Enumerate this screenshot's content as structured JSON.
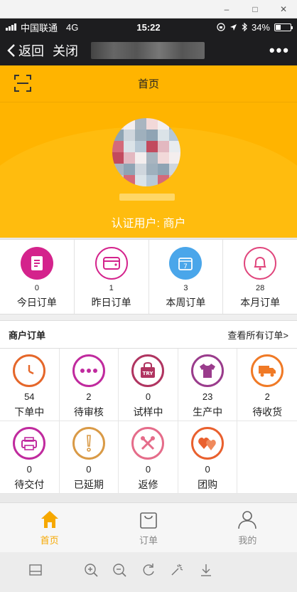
{
  "status": {
    "carrier": "中国联通",
    "network": "4G",
    "time": "15:22",
    "battery": "34%",
    "battery_level": 0.34
  },
  "nav": {
    "back": "返回",
    "close": "关闭",
    "more": "•••"
  },
  "appbar": {
    "title": "首页"
  },
  "hero": {
    "verified": "认证用户: 商户"
  },
  "stats": [
    {
      "num": "0",
      "label": "今日订单",
      "icon": "document-icon",
      "color": "#d4238c"
    },
    {
      "num": "1",
      "label": "昨日订单",
      "icon": "wallet-icon",
      "color": "#d4238c"
    },
    {
      "num": "3",
      "label": "本周订单",
      "icon": "calendar-icon",
      "color": "#4aa6ea"
    },
    {
      "num": "28",
      "label": "本月订单",
      "icon": "bell-icon",
      "color": "#e0457c"
    }
  ],
  "merchant": {
    "title": "商户订单",
    "view_all": "查看所有订单>"
  },
  "orders": [
    {
      "num": "54",
      "label": "下单中",
      "icon": "clock-icon",
      "color": "#e5672a"
    },
    {
      "num": "2",
      "label": "待审核",
      "icon": "dots-icon",
      "color": "#c02a9e"
    },
    {
      "num": "0",
      "label": "试样中",
      "icon": "try-bag-icon",
      "color": "#b03460"
    },
    {
      "num": "23",
      "label": "生产中",
      "icon": "tshirt-icon",
      "color": "#9a3c8c"
    },
    {
      "num": "2",
      "label": "待收货",
      "icon": "truck-icon",
      "color": "#f07a26"
    },
    {
      "num": "0",
      "label": "待交付",
      "icon": "printer-icon",
      "color": "#c02a9e"
    },
    {
      "num": "0",
      "label": "已延期",
      "icon": "exclamation-icon",
      "color": "#d99a46"
    },
    {
      "num": "0",
      "label": "返修",
      "icon": "tools-icon",
      "color": "#e56c8a"
    },
    {
      "num": "0",
      "label": "团购",
      "icon": "hearts-icon",
      "color": "#e9602e"
    }
  ],
  "tabs": [
    {
      "label": "首页",
      "icon": "home-icon"
    },
    {
      "label": "订单",
      "icon": "bag-icon"
    },
    {
      "label": "我的",
      "icon": "user-icon"
    }
  ],
  "toolbar": [
    "layout-icon",
    "zoom-in-icon",
    "zoom-out-icon",
    "rotate-icon",
    "magic-wand-icon",
    "download-icon"
  ],
  "window": {
    "minimize": "–",
    "maximize": "□",
    "close": "✕"
  }
}
